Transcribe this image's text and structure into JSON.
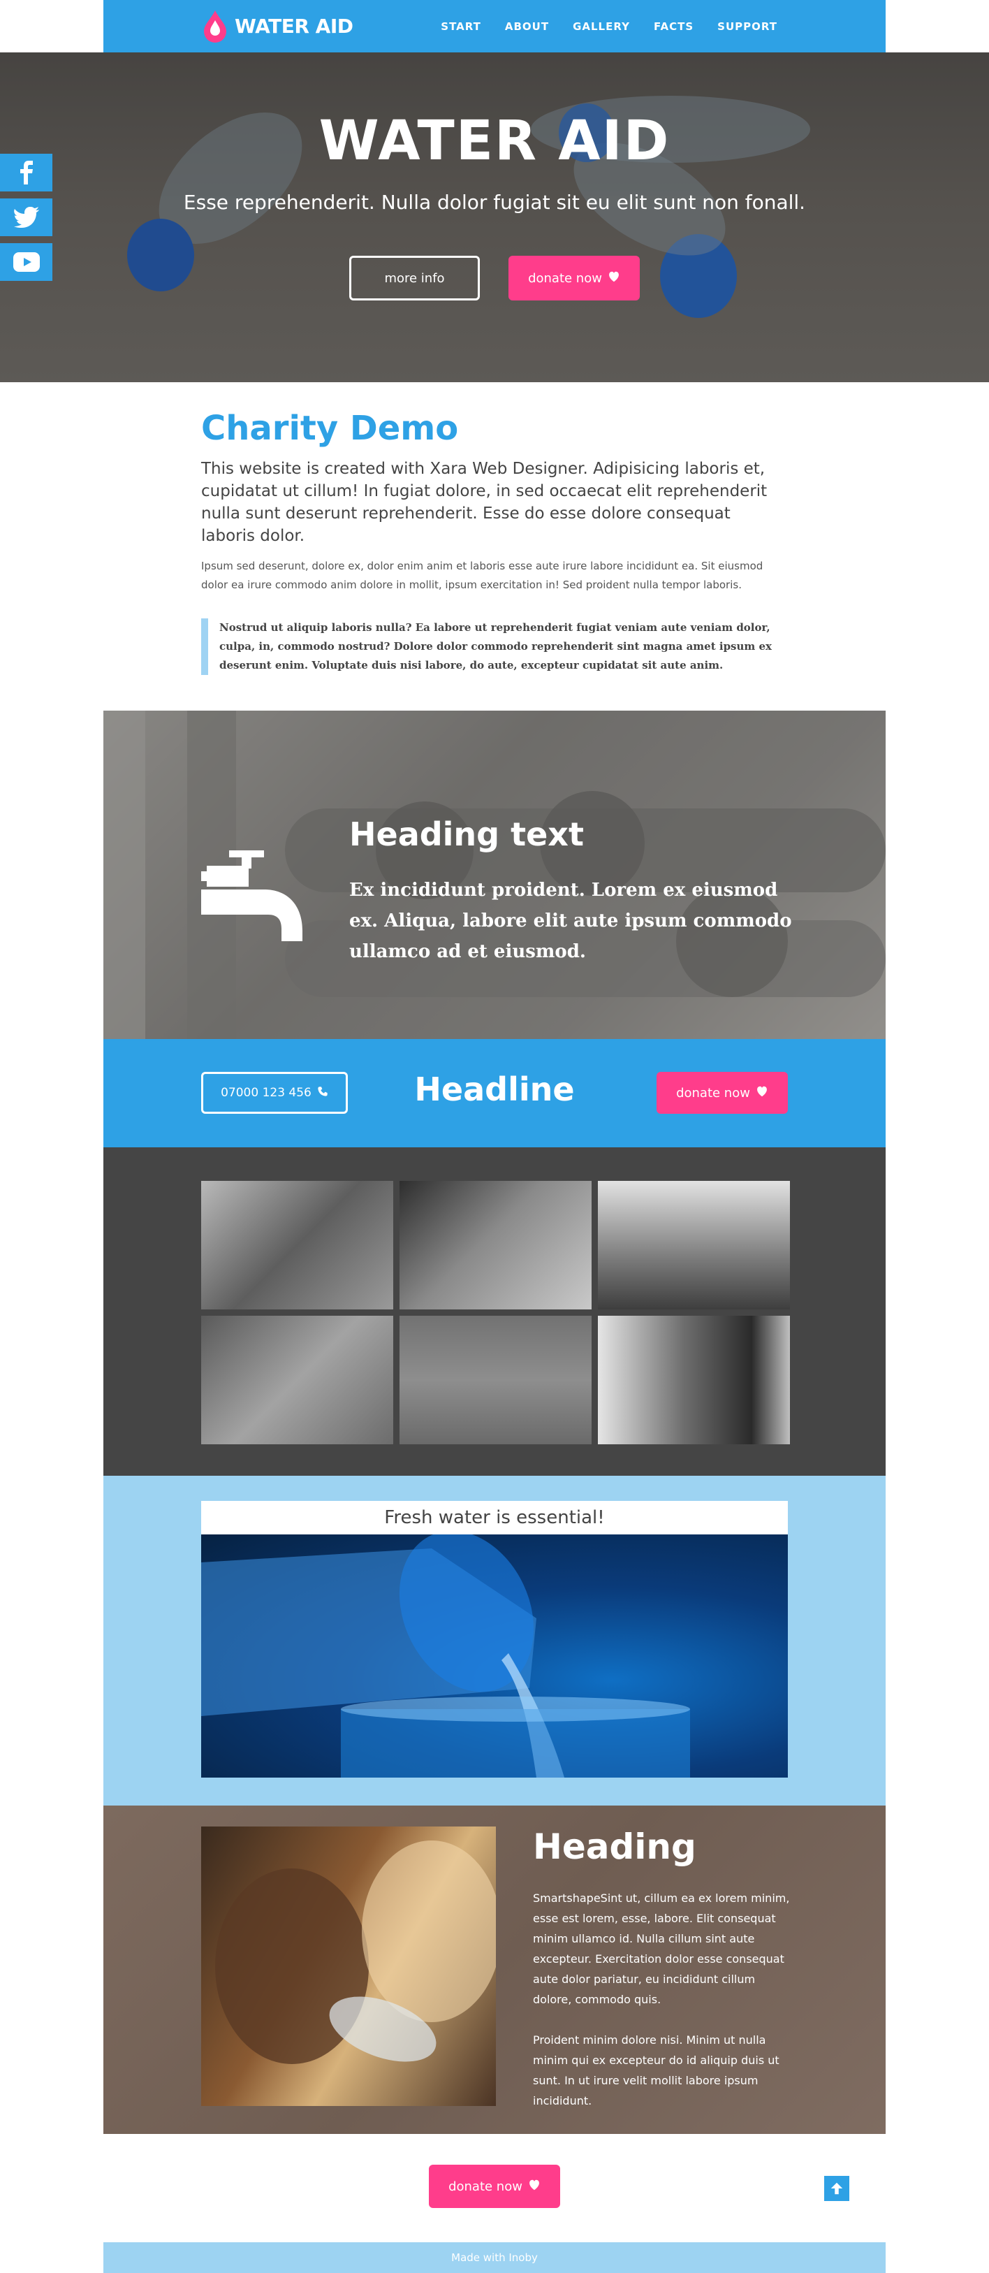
{
  "brand": {
    "name": "WATER AID",
    "accent": "#2ea1e5",
    "pink": "#ff3d8b",
    "light_blue": "#9dd3f2"
  },
  "nav": {
    "items": [
      "START",
      "ABOUT",
      "GALLERY",
      "FACTS",
      "SUPPORT"
    ]
  },
  "social": {
    "icons": [
      "facebook-icon",
      "twitter-icon",
      "youtube-icon"
    ]
  },
  "hero": {
    "title": "WATER AID",
    "subtitle": "Esse reprehenderit. Nulla dolor fugiat sit eu elit sunt non fonall.",
    "more_label": "more info",
    "donate_label": "donate now"
  },
  "intro": {
    "title": "Charity Demo",
    "lead": "This website is created with Xara Web Designer. Adipisicing laboris et, cupidatat ut cillum! In fugiat dolore, in sed occaecat elit reprehenderit nulla sunt deserunt reprehenderit. Esse do esse dolore consequat laboris dolor.",
    "body": "Ipsum sed deserunt, dolore ex, dolor enim anim et laboris esse aute irure labore incididunt ea. Sit eiusmod dolor ea irure commodo anim dolore in mollit, ipsum exercitation in! Sed proident nulla tempor laboris.",
    "quote": "Nostrud ut aliquip laboris nulla? Ea labore ut reprehenderit fugiat veniam aute veniam dolor, culpa, in, commodo nostrud? Dolore dolor commodo reprehenderit sint magna amet ipsum ex deserunt enim. Voluptate duis nisi labore, do aute, excepteur cupidatat sit aute anim."
  },
  "feature": {
    "heading": "Heading text",
    "text": "Ex incididunt proident. Lorem ex eiusmod ex. Aliqua, labore elit aute ipsum commodo ullamco ad et eiusmod."
  },
  "cta_bar": {
    "phone": "07000 123 456",
    "headline": "Headline",
    "donate_label": "donate now"
  },
  "fresh": {
    "caption": "Fresh water is essential!"
  },
  "story": {
    "heading": "Heading",
    "para1": "SmartshapeSint ut, cillum ea ex lorem minim, esse est lorem, esse, labore. Elit consequat minim ullamco id. Nulla cillum sint aute excepteur. Exercitation dolor esse consequat aute dolor pariatur, eu incididunt cillum dolore, commodo quis.",
    "para2": "Proident minim dolore nisi. Minim ut nulla minim qui ex excepteur do id aliquip duis ut sunt. In ut irure velit mollit labore ipsum incididunt."
  },
  "footer": {
    "donate_label": "donate now",
    "credit": "Made with Inoby"
  }
}
